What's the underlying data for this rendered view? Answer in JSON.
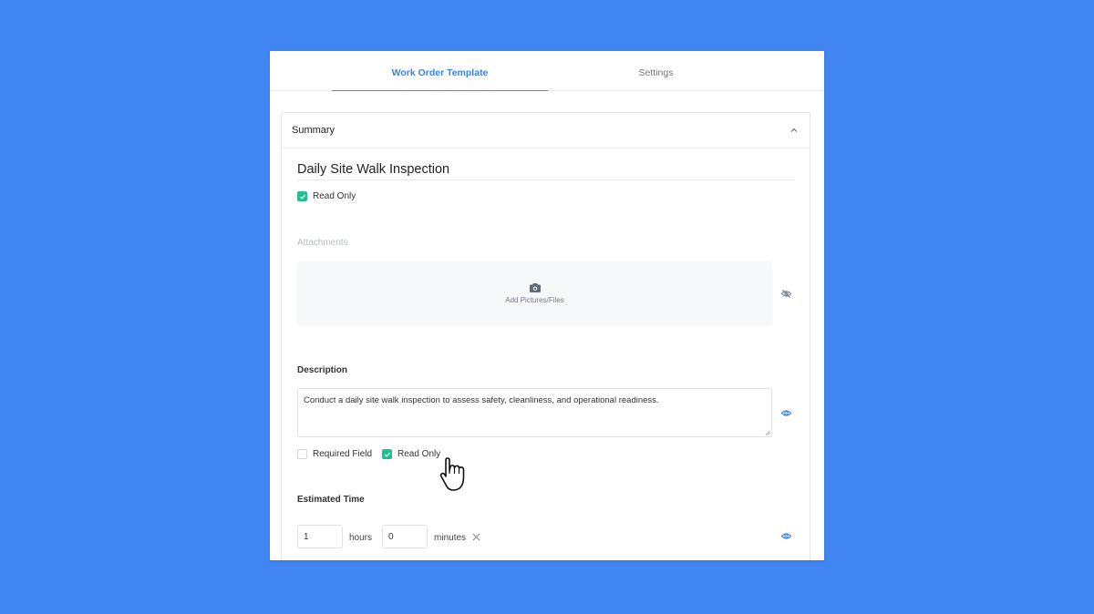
{
  "tabs": [
    {
      "label": "Work Order Template",
      "active": true
    },
    {
      "label": "Settings",
      "active": false
    }
  ],
  "summary": {
    "title": "Summary",
    "collapse_icon": "chevron-up-icon",
    "name_value": "Daily Site Walk Inspection",
    "read_only": {
      "label": "Read Only",
      "checked": true
    }
  },
  "attachments": {
    "label": "Attachments",
    "dropzone_icon": "camera-icon",
    "dropzone_text": "Add Pictures/Files",
    "visibility_icon": "eye-off-icon"
  },
  "description": {
    "label": "Description",
    "value": "Conduct a daily site walk inspection to assess safety, cleanliness, and operational readiness.",
    "visibility_icon": "eye-icon",
    "required": {
      "label": "Required Field",
      "checked": false
    },
    "read_only": {
      "label": "Read Only",
      "checked": true
    }
  },
  "estimated_time": {
    "label": "Estimated Time",
    "hours_value": "1",
    "hours_unit": "hours",
    "minutes_value": "0",
    "minutes_unit": "minutes",
    "clear_icon": "close-icon",
    "visibility_icon": "eye-icon"
  },
  "colors": {
    "background": "#4286f4",
    "accent": "#3b82e8",
    "check_green": "#1fbf8f"
  }
}
